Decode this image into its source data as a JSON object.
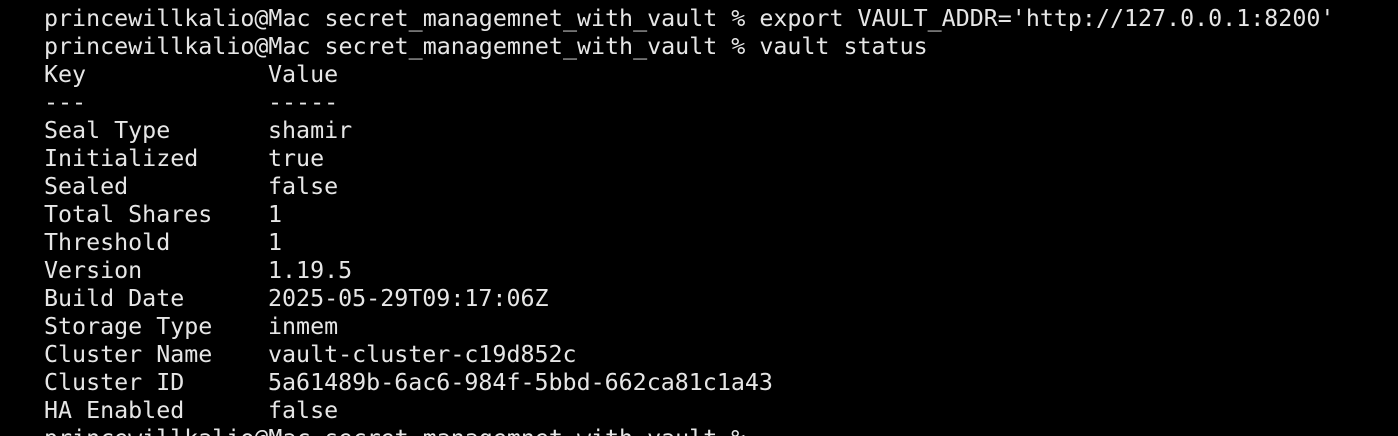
{
  "terminal": {
    "prompt": "princewillkalio@Mac secret_managemnet_with_vault %",
    "commands": [
      "export VAULT_ADDR='http://127.0.0.1:8200'",
      "vault status"
    ],
    "header": {
      "key": "Key",
      "value": "Value"
    },
    "separator": {
      "key": "---",
      "value": "-----"
    },
    "rows": [
      {
        "key": "Seal Type",
        "value": "shamir"
      },
      {
        "key": "Initialized",
        "value": "true"
      },
      {
        "key": "Sealed",
        "value": "false"
      },
      {
        "key": "Total Shares",
        "value": "1"
      },
      {
        "key": "Threshold",
        "value": "1"
      },
      {
        "key": "Version",
        "value": "1.19.5"
      },
      {
        "key": "Build Date",
        "value": "2025-05-29T09:17:06Z"
      },
      {
        "key": "Storage Type",
        "value": "inmem"
      },
      {
        "key": "Cluster Name",
        "value": "vault-cluster-c19d852c"
      },
      {
        "key": "Cluster ID",
        "value": "5a61489b-6ac6-984f-5bbd-662ca81c1a43"
      },
      {
        "key": "HA Enabled",
        "value": "false"
      }
    ]
  }
}
